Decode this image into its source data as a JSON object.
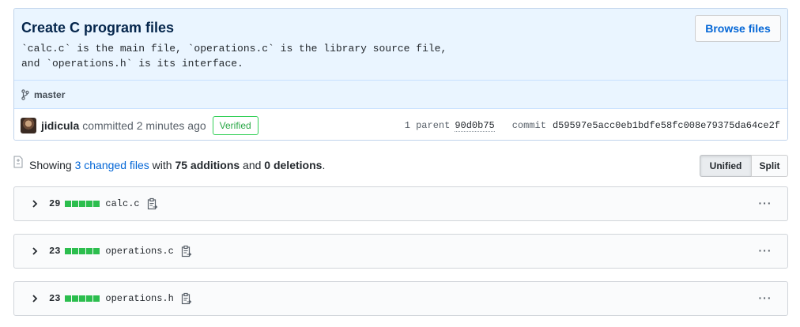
{
  "commit": {
    "title": "Create C program files",
    "description": "`calc.c` is the main file, `operations.c` is the library source file,\nand `operations.h` is its interface.",
    "browse_label": "Browse files",
    "branch": "master",
    "author": "jidicula",
    "committed_text": "committed 2 minutes ago",
    "verified_label": "Verified",
    "parent_label": "1 parent",
    "parent_sha": "90d0b75",
    "commit_label": "commit",
    "commit_sha": "d59597e5acc0eb1bdfe58fc008e79375da64ce2f"
  },
  "toc": {
    "showing": "Showing",
    "changed_files": "3 changed files",
    "with": "with",
    "additions": "75 additions",
    "and": "and",
    "deletions": "0 deletions",
    "period": ".",
    "unified_label": "Unified",
    "split_label": "Split"
  },
  "files": [
    {
      "count": "29",
      "name": "calc.c",
      "more": "···"
    },
    {
      "count": "23",
      "name": "operations.c",
      "more": "···"
    },
    {
      "count": "23",
      "name": "operations.h",
      "more": "···"
    }
  ],
  "colors": {
    "accent": "#0366d6",
    "addition": "#2cbe4e",
    "header_bg": "#eaf5ff",
    "verified": "#28a745"
  }
}
